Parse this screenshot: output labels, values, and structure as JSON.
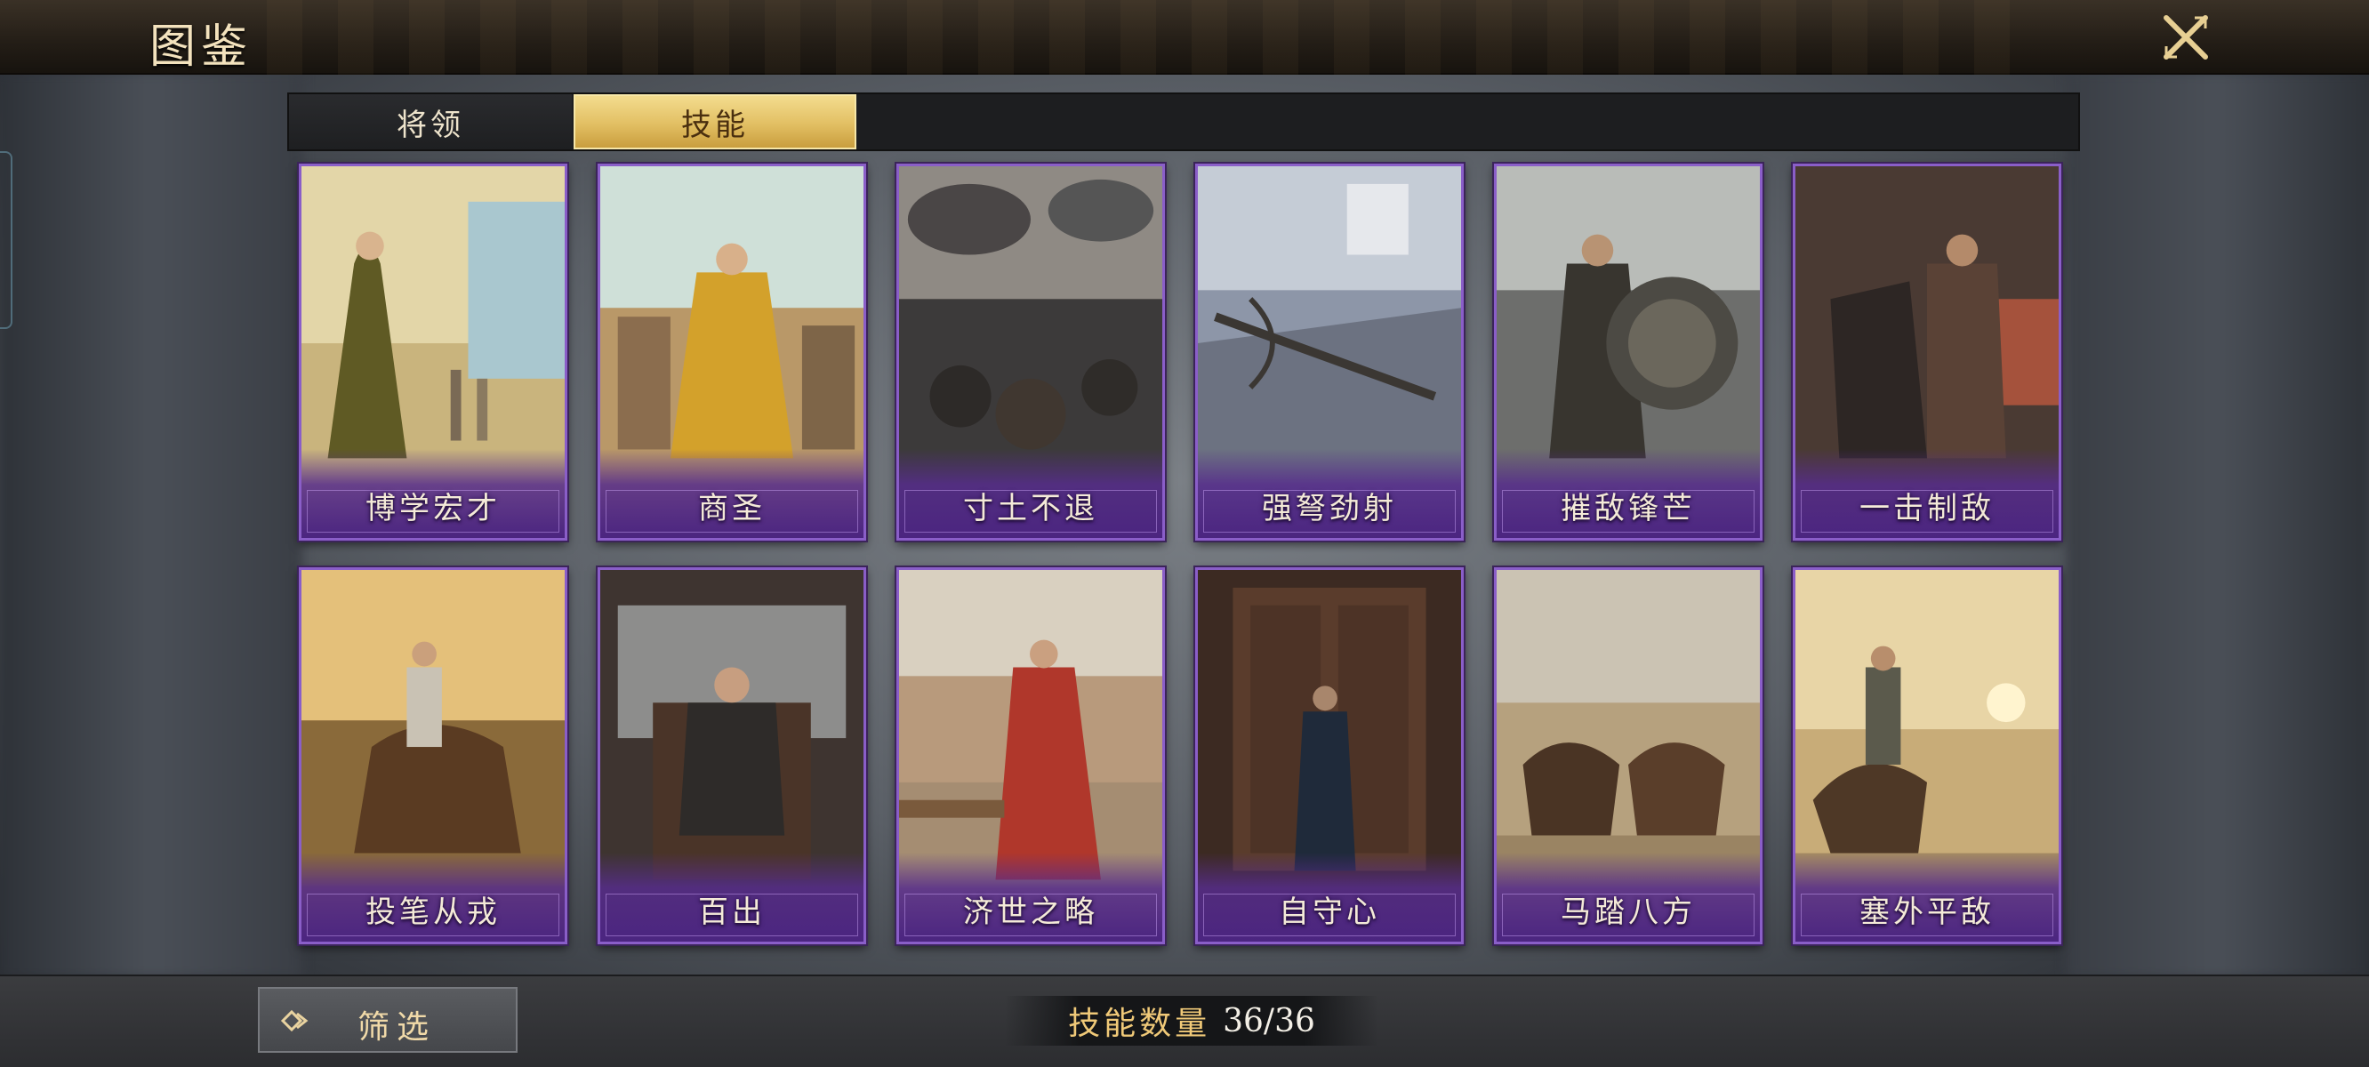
{
  "header": {
    "title": "图鉴",
    "close_icon": "close-x-icon"
  },
  "tabs": [
    {
      "label": "将领",
      "active": false
    },
    {
      "label": "技能",
      "active": true
    }
  ],
  "cards": [
    {
      "name": "博学宏才"
    },
    {
      "name": "商圣"
    },
    {
      "name": "寸土不退"
    },
    {
      "name": "强弩劲射"
    },
    {
      "name": "摧敌锋芒"
    },
    {
      "name": "一击制敌"
    },
    {
      "name": "投笔从戎"
    },
    {
      "name": "百出"
    },
    {
      "name": "济世之略"
    },
    {
      "name": "自守心"
    },
    {
      "name": "马踏八方"
    },
    {
      "name": "塞外平敌"
    }
  ],
  "footer": {
    "filter_label": "筛选",
    "filter_icon": "diamond-arrow-icon",
    "count_label": "技能数量",
    "count_value": "36/36"
  },
  "colors": {
    "card_border": "#8a5ec8",
    "card_band": "#4b2580",
    "tab_active": "#e2bf63",
    "count_label": "#f0c978"
  }
}
